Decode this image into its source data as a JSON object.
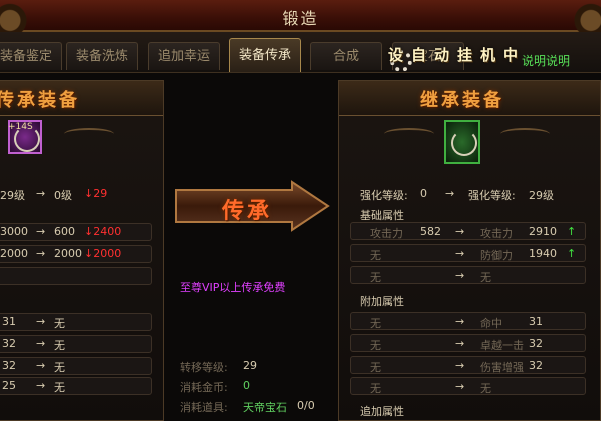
{
  "window": {
    "title": "锻造"
  },
  "tabs": [
    {
      "label": "装备鉴定"
    },
    {
      "label": "装备洗炼"
    },
    {
      "label": "追加幸运"
    },
    {
      "label": "装备传承"
    },
    {
      "label": "合成"
    },
    {
      "label": "宝石"
    }
  ],
  "auto_button": {
    "label": "设自动挂机中"
  },
  "help_link": {
    "label": "说明说明"
  },
  "left_panel": {
    "title": "传承装备",
    "item": {
      "enhance": "+14S",
      "icon": "necklace-icon"
    },
    "level_row": {
      "from": "29级",
      "arrow": "→",
      "to": "0级",
      "delta": "↓29"
    },
    "stat_rows": [
      {
        "from": "3000",
        "arrow": "→",
        "to": "600",
        "delta": "↓2400"
      },
      {
        "from": "2000",
        "arrow": "→",
        "to": "2000",
        "delta": "↓2000"
      }
    ],
    "extra_rows": [
      {
        "from": "31",
        "arrow": "→",
        "to": "无"
      },
      {
        "from": "32",
        "arrow": "→",
        "to": "无"
      },
      {
        "from": "32",
        "arrow": "→",
        "to": "无"
      },
      {
        "from": "25",
        "arrow": "→",
        "to": "无"
      }
    ]
  },
  "center": {
    "button_label": "传承",
    "vip_note": "至尊VIP以上传承免费",
    "transfer_level_label": "转移等级:",
    "transfer_level_value": "29",
    "gold_cost_label": "消耗金币:",
    "gold_cost_value": "0",
    "item_cost_label": "消耗道具:",
    "item_cost_name": "天帝宝石",
    "item_cost_count": "0/0"
  },
  "right_panel": {
    "title": "继承装备",
    "item": {
      "icon": "necklace-icon"
    },
    "enhance_row": {
      "label_from": "强化等级:",
      "from": "0",
      "arrow": "→",
      "label_to": "强化等级:",
      "to": "29级"
    },
    "base_section_label": "基础属性",
    "base_rows": [
      {
        "from_label": "攻击力",
        "from": "582",
        "arrow": "→",
        "to_label": "攻击力",
        "to": "2910",
        "trend": "↑"
      },
      {
        "from_label": "无",
        "from": "",
        "arrow": "→",
        "to_label": "防御力",
        "to": "1940",
        "trend": "↑"
      },
      {
        "from_label": "无",
        "from": "",
        "arrow": "→",
        "to_label": "无",
        "to": "",
        "trend": ""
      }
    ],
    "extra_section_label": "附加属性",
    "extra_rows": [
      {
        "from_label": "无",
        "arrow": "→",
        "to_label": "命中",
        "to": "31"
      },
      {
        "from_label": "无",
        "arrow": "→",
        "to_label": "卓越一击",
        "to": "32"
      },
      {
        "from_label": "无",
        "arrow": "→",
        "to_label": "伤害增强",
        "to": "32"
      },
      {
        "from_label": "无",
        "arrow": "→",
        "to_label": "无",
        "to": ""
      }
    ],
    "append_section_label": "追加属性"
  },
  "colors": {
    "accent_gold": "#a7884c",
    "header_orange": "#f0a040",
    "up_green": "#40e040",
    "down_red": "#ff3030",
    "vip_purple": "#e040ff"
  }
}
